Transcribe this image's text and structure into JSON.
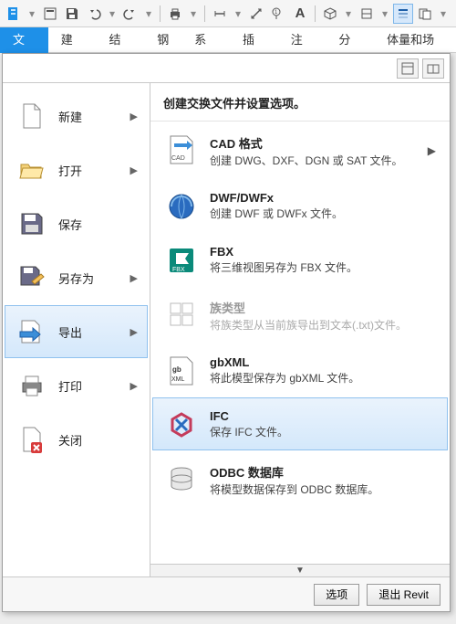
{
  "tabs": {
    "file": "文件",
    "arch": "建筑",
    "struct": "结构",
    "steel": "钢",
    "sys": "系统",
    "insert": "插入",
    "annot": "注释",
    "analy": "分析",
    "mass": "体量和场地"
  },
  "menu": {
    "new": "新建",
    "open": "打开",
    "save": "保存",
    "saveas": "另存为",
    "export": "导出",
    "print": "打印",
    "close": "关闭"
  },
  "right": {
    "header": "创建交换文件并设置选项。",
    "items": {
      "cad": {
        "title": "CAD 格式",
        "desc": "创建 DWG、DXF、DGN 或 SAT 文件。"
      },
      "dwf": {
        "title": "DWF/DWFx",
        "desc": "创建 DWF 或 DWFx 文件。"
      },
      "fbx": {
        "title": "FBX",
        "desc": "将三维视图另存为 FBX 文件。"
      },
      "fam": {
        "title": "族类型",
        "desc": "将族类型从当前族导出到文本(.txt)文件。"
      },
      "gbx": {
        "title": "gbXML",
        "desc": "将此模型保存为 gbXML 文件。"
      },
      "ifc": {
        "title": "IFC",
        "desc": "保存 IFC 文件。"
      },
      "odbc": {
        "title": "ODBC 数据库",
        "desc": "将模型数据保存到 ODBC 数据库。"
      }
    }
  },
  "footer": {
    "options": "选项",
    "exit": "退出 Revit"
  }
}
